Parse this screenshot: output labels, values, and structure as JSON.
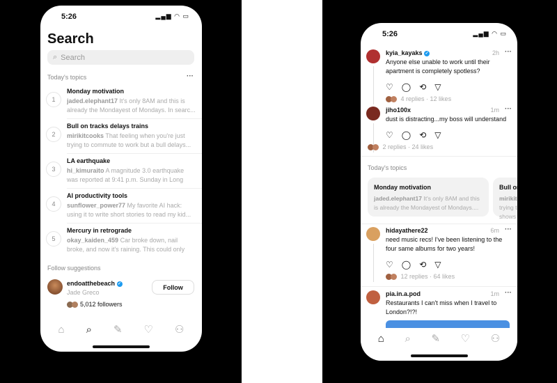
{
  "left": {
    "status_time": "5:26",
    "title": "Search",
    "search_placeholder": "Search",
    "topics_header": "Today's topics",
    "topics": [
      {
        "num": "1",
        "title": "Monday motivation",
        "user": "jaded.elephant17",
        "text": "It's only 8AM and this is already the Mondayest of Mondays. In searc..."
      },
      {
        "num": "2",
        "title": "Bull on tracks delays trains",
        "user": "mirikitcooks",
        "text": "That feeling when you're just trying to commute to work but a bull delays..."
      },
      {
        "num": "3",
        "title": "LA earthquake",
        "user": "hi_kimuraito",
        "text": "A magnitude 3.0 earthquake was reported at 9:41 p.m. Sunday in Long Beach..."
      },
      {
        "num": "4",
        "title": "AI productivity tools",
        "user": "sunflower_power77",
        "text": "My favorite AI hack: using it to write short stories to read my kid..."
      },
      {
        "num": "5",
        "title": "Mercury in retrograde",
        "user": "okay_kaiden_459",
        "text": "Car broke down, nail broke, and now it's raining. This could only mean on..."
      }
    ],
    "follow_header": "Follow suggestions",
    "suggestion": {
      "username": "endoatthebeach",
      "name": "Jade Greco",
      "followers": "5,012 followers",
      "button": "Follow"
    }
  },
  "right": {
    "status_time": "5:26",
    "posts": [
      {
        "user": "kyia_kayaks",
        "verified": true,
        "time": "2h",
        "text": "Anyone else unable to work until their apartment is completely spotless?",
        "replies": "4 replies",
        "likes": "12 likes"
      },
      {
        "user": "jiho100x",
        "time": "1m",
        "text": "dust is distracting...my boss will understand",
        "replies": "2 replies",
        "likes": "24 likes"
      },
      {
        "user": "hidayathere22",
        "time": "6m",
        "text": "need music recs! I've been listening to the four same albums for two years!",
        "replies": "12 replies",
        "likes": "64 likes"
      },
      {
        "user": "pia.in.a.pod",
        "time": "1m",
        "text": "Restaurants I can't miss when I travel to London?!?!"
      }
    ],
    "topics_header": "Today's topics",
    "cards": [
      {
        "title": "Monday motivation",
        "user": "jaded.elephant17",
        "text": "It's only 8AM and this is already the Mondayest of Mondays...."
      },
      {
        "title": "Bull on tracks",
        "user": "mirikitcooks",
        "text": "That feeling when you're trying to commute to work but a bull shows up unbothered"
      }
    ]
  },
  "colors": {
    "verified": "#1d9bf0",
    "link_preview": "#4a90e2"
  }
}
